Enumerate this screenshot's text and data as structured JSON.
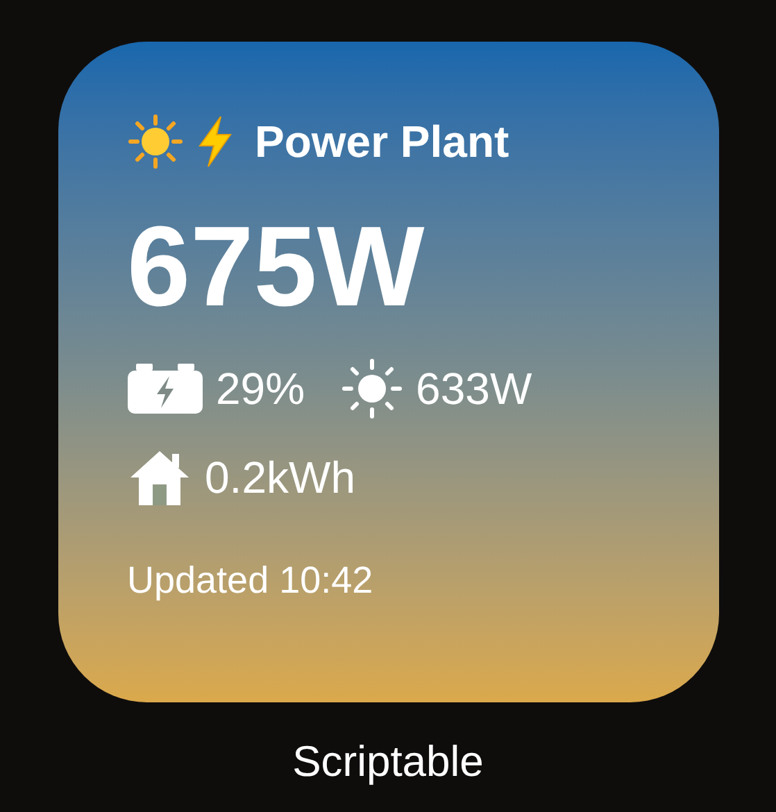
{
  "widget": {
    "title": "Power Plant",
    "power": "675W",
    "stats": [
      {
        "kind": "battery",
        "value": "29%"
      },
      {
        "kind": "solar",
        "value": "633W"
      },
      {
        "kind": "home",
        "value": "0.2kWh"
      }
    ],
    "updated": "Updated 10:42"
  },
  "app_label": "Scriptable"
}
